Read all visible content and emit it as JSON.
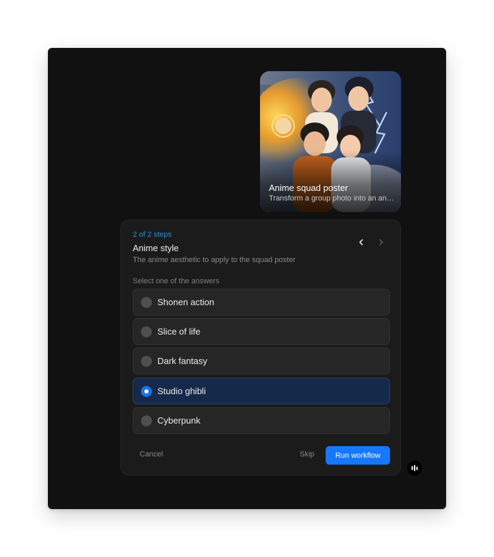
{
  "card": {
    "title": "Anime squad poster",
    "subtitle": "Transform a group photo into an anime squad poster"
  },
  "question": {
    "step_counter": "2 of 2 steps",
    "title": "Anime style",
    "description": "The anime aesthetic to apply to the squad poster",
    "hint": "Select one of the answers",
    "options": [
      {
        "label": "Shonen action",
        "selected": false
      },
      {
        "label": "Slice of life",
        "selected": false
      },
      {
        "label": "Dark fantasy",
        "selected": false
      },
      {
        "label": "Studio ghibli",
        "selected": true
      },
      {
        "label": "Cyberpunk",
        "selected": false
      }
    ],
    "nav_icons": [
      "chevron-left-icon",
      "chevron-right-icon"
    ]
  },
  "footer": {
    "cancel_label": "Cancel",
    "skip_label": "Skip",
    "run_label": "Run workflow"
  },
  "colors": {
    "accent": "#1677ff",
    "step_counter": "#2d8fd6",
    "selected_bg": "#152a4a",
    "window_bg": "#111111",
    "panel_bg": "#1b1b1b"
  },
  "badge_icon": "audio-bars-icon"
}
